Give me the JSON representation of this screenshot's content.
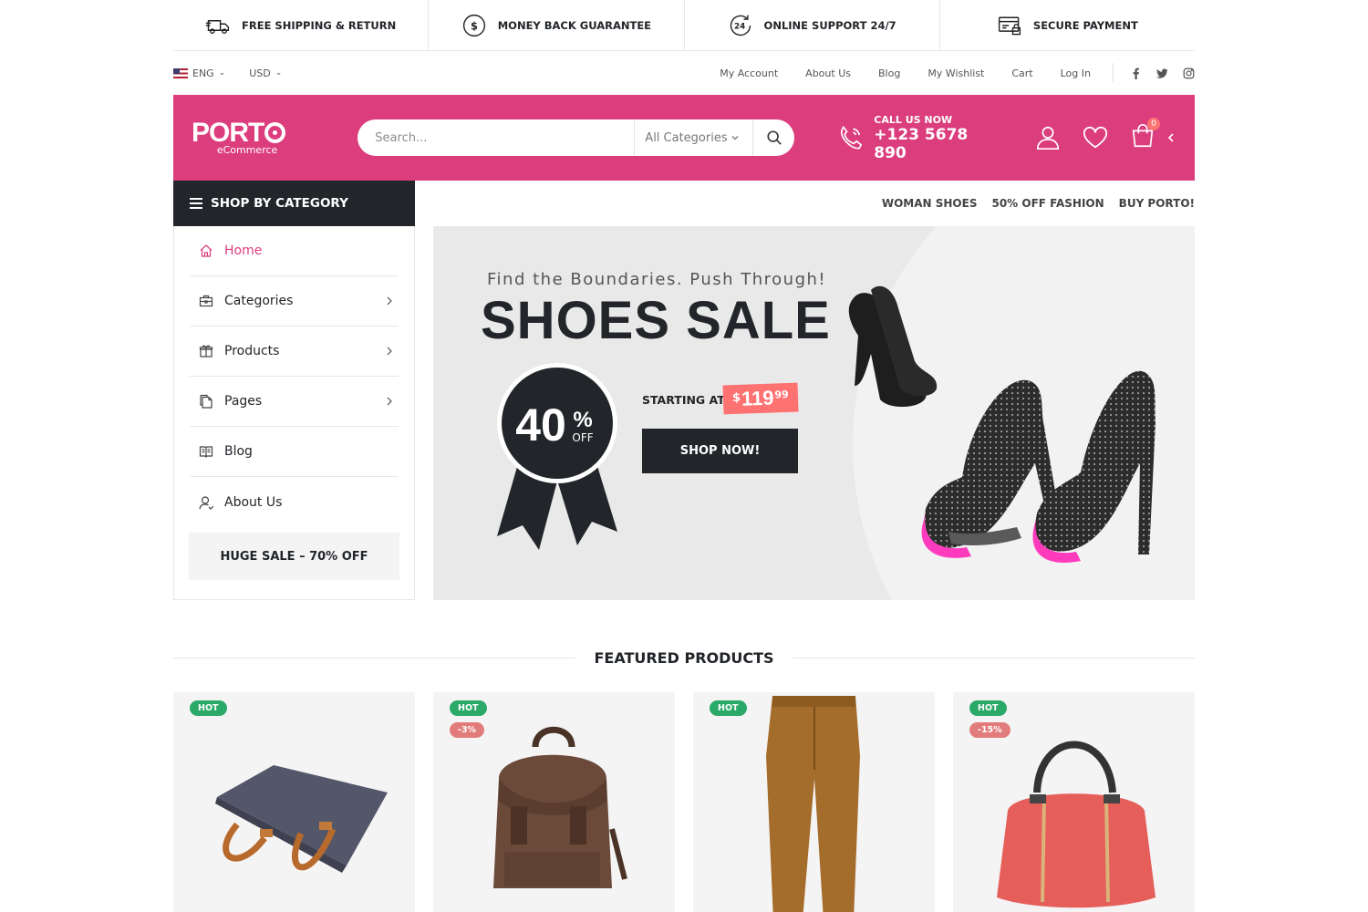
{
  "infobar": [
    {
      "label": "FREE SHIPPING & RETURN",
      "icon": "truck-icon"
    },
    {
      "label": "MONEY BACK GUARANTEE",
      "icon": "dollar-circle-icon"
    },
    {
      "label": "ONLINE SUPPORT 24/7",
      "icon": "support-24-icon"
    },
    {
      "label": "SECURE PAYMENT",
      "icon": "secure-payment-icon"
    }
  ],
  "topbar": {
    "language": "ENG",
    "currency": "USD",
    "links": [
      "My Account",
      "About Us",
      "Blog",
      "My Wishlist",
      "Cart",
      "Log In"
    ]
  },
  "header": {
    "logo_brand": "PORT",
    "logo_sub": "eCommerce",
    "search_placeholder": "Search...",
    "category_select": "All Categories",
    "call_label": "CALL US NOW",
    "phone": "+123 5678 890",
    "cart_count": "0",
    "accent_color": "#dc3d7d"
  },
  "sidebar": {
    "title": "SHOP BY CATEGORY",
    "items": [
      {
        "label": "Home",
        "icon": "home-icon"
      },
      {
        "label": "Categories",
        "icon": "briefcase-icon"
      },
      {
        "label": "Products",
        "icon": "gift-icon"
      },
      {
        "label": "Pages",
        "icon": "pages-icon"
      },
      {
        "label": "Blog",
        "icon": "book-icon"
      },
      {
        "label": "About Us",
        "icon": "user-outline-icon"
      }
    ],
    "promo": "HUGE SALE – 70% OFF"
  },
  "banner_links": [
    "WOMAN SHOES",
    "50% OFF FASHION",
    "BUY PORTO!"
  ],
  "banner": {
    "subtitle": "Find the Boundaries. Push Through!",
    "title": "SHOES SALE",
    "discount": "40",
    "discount_pct": "%",
    "discount_off": "OFF",
    "starting_at": "STARTING AT",
    "price_currency": "$",
    "price_int": "119",
    "price_cents": "99",
    "cta": "SHOP NOW!"
  },
  "featured": {
    "title": "FEATURED PRODUCTS",
    "products": [
      {
        "labels": [
          "HOT"
        ],
        "image": "laptop-bag"
      },
      {
        "labels": [
          "HOT",
          "-3%"
        ],
        "image": "backpack"
      },
      {
        "labels": [
          "HOT"
        ],
        "image": "trousers"
      },
      {
        "labels": [
          "HOT",
          "-15%"
        ],
        "image": "handbag"
      }
    ]
  }
}
